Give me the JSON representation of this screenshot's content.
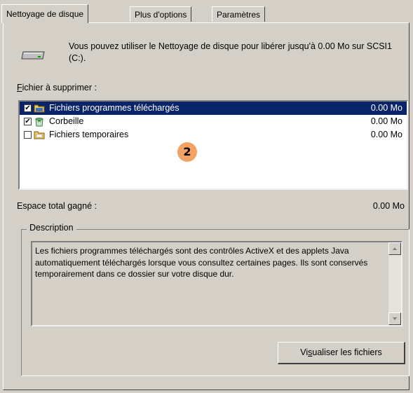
{
  "tabs": [
    {
      "label": "Nettoyage de disque",
      "active": true
    },
    {
      "label": "Plus d'options",
      "active": false
    },
    {
      "label": "Paramètres",
      "active": false
    }
  ],
  "intro": "Vous pouvez utiliser le Nettoyage de disque pour libérer jusqu'à 0.00 Mo sur SCSI1 (C:).",
  "files_label_first": "F",
  "files_label_rest": "ichier à supprimer :",
  "files": [
    {
      "name": "Fichiers programmes téléchargés",
      "size": "0.00 Mo",
      "checked": true,
      "selected": true,
      "icon": "folder-icon"
    },
    {
      "name": "Corbeille",
      "size": "0.00 Mo",
      "checked": true,
      "selected": false,
      "icon": "recycle-bin-icon"
    },
    {
      "name": "Fichiers temporaires",
      "size": "0.00 Mo",
      "checked": false,
      "selected": false,
      "icon": "folder-icon"
    }
  ],
  "badge": "2",
  "space_label": "Espace total gagné :",
  "space_value": "0.00 Mo",
  "description_title": "Description",
  "description_text": "Les fichiers programmes téléchargés sont des contrôles ActiveX et des applets Java automatiquement téléchargés lorsque vous consultez certaines pages. Ils sont conservés temporairement dans ce dossier sur votre disque dur.",
  "view_button_before": "Vi",
  "view_button_mnemonic": "s",
  "view_button_after": "ualiser les fichiers",
  "colors": {
    "selection": "#0a246a",
    "dialog_bg": "#d4d0c8",
    "badge": "#f4a261"
  }
}
